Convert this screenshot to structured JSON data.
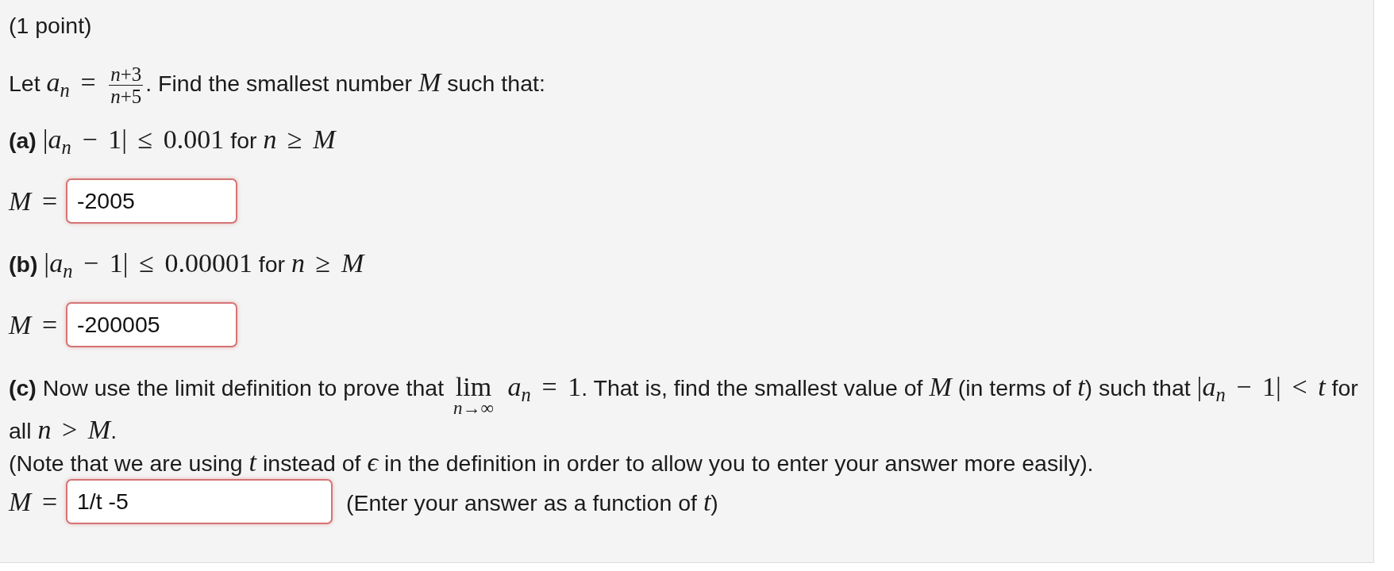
{
  "points": "(1 point)",
  "statement": [
    {
      "kind": "text",
      "text": "Let "
    },
    {
      "kind": "math",
      "text": "*a*$_{n}$ = "
    },
    {
      "kind": "fraction",
      "numerator": "*n*+3",
      "denominator": "*n*+5"
    },
    {
      "kind": "text",
      "text": ". Find the smallest number "
    },
    {
      "kind": "math",
      "text": "*M*"
    },
    {
      "kind": "text",
      "text": " such that:"
    }
  ],
  "parts": [
    {
      "question": [
        {
          "kind": "text",
          "text": "**(a)** "
        },
        {
          "kind": "math",
          "text": "|*a*$_{n}$ − 1| ≤ 0.001"
        },
        {
          "kind": "text",
          "text": " for "
        },
        {
          "kind": "math",
          "text": "*n* ≥ *M*"
        }
      ],
      "answer": {
        "kind": "number",
        "label": "*M* =",
        "value": "-2005",
        "correct": false
      }
    },
    {
      "question": [
        {
          "kind": "text",
          "text": "**(b)** "
        },
        {
          "kind": "math",
          "text": "|*a*$_{n}$ − 1| ≤ 0.00001"
        },
        {
          "kind": "text",
          "text": " for "
        },
        {
          "kind": "math",
          "text": "*n* ≥ *M*"
        }
      ],
      "answer": {
        "kind": "number",
        "label": "*M* =",
        "value": "-200005",
        "correct": false
      }
    },
    {
      "question": [
        {
          "kind": "text",
          "text": "**(c)** Now use the limit definition to prove that "
        },
        {
          "kind": "limit",
          "operator": "lim",
          "under": "*n*→∞"
        },
        {
          "kind": "math",
          "text": " *a*$_{n}$ = 1"
        },
        {
          "kind": "text",
          "text": ". That is, find the smallest value of "
        },
        {
          "kind": "math",
          "text": "*M*"
        },
        {
          "kind": "text",
          "text": " (in terms of "
        },
        {
          "kind": "math",
          "text": "*t*"
        },
        {
          "kind": "text",
          "text": ") such that "
        },
        {
          "kind": "math",
          "text": "|*a*$_{n}$ − 1| < *t*"
        },
        {
          "kind": "text",
          "text": " for all "
        },
        {
          "kind": "math",
          "text": "*n* > *M*"
        },
        {
          "kind": "text",
          "text": "."
        }
      ],
      "note": [
        {
          "kind": "text",
          "text": "(Note that we are using "
        },
        {
          "kind": "math",
          "text": "*t*"
        },
        {
          "kind": "text",
          "text": " instead of "
        },
        {
          "kind": "math",
          "text": "*ϵ*"
        },
        {
          "kind": "text",
          "text": " in the definition in order to allow you to enter your answer more easily)."
        }
      ],
      "answer": {
        "kind": "formula",
        "label": "*M* =",
        "value": "1/t -5",
        "correct": false,
        "hint": [
          {
            "kind": "text",
            "text": "(Enter your answer as a function of "
          },
          {
            "kind": "math",
            "text": "*t*"
          },
          {
            "kind": "text",
            "text": ")"
          }
        ]
      }
    }
  ]
}
